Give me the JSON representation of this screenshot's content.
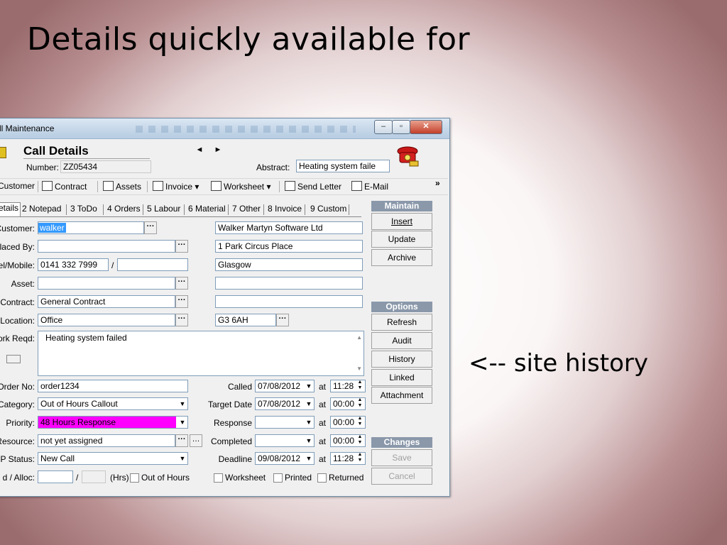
{
  "slide": {
    "title": "Details quickly available for",
    "annotation": "<-- site history"
  },
  "window": {
    "title": "ll Maintenance",
    "controls": {
      "minimize": "–",
      "maximize": "▫",
      "close": "✕"
    }
  },
  "header": {
    "title": "Call Details",
    "number_label": "Number:",
    "number_value": "ZZ05434",
    "abstract_label": "Abstract:",
    "abstract_value": "Heating system faile",
    "nav_prev": "◄",
    "nav_next": "►"
  },
  "toolbar": {
    "items": [
      "Customer",
      "Contract",
      "Assets",
      "Invoice",
      "Worksheet",
      "Send Letter",
      "E-Mail"
    ],
    "overflow": "»"
  },
  "tabs": [
    {
      "label": "etails"
    },
    {
      "label": "2 Notepad"
    },
    {
      "label": "3 ToDo"
    },
    {
      "label": "4 Orders"
    },
    {
      "label": "5 Labour"
    },
    {
      "label": "6 Material"
    },
    {
      "label": "7 Other"
    },
    {
      "label": "8 Invoice"
    },
    {
      "label": "9 Custom"
    }
  ],
  "form": {
    "customer_label": "Customer:",
    "customer_value": "walker",
    "placed_by_label": "laced By:",
    "placed_by_value": "",
    "tel_label": "el/Mobile:",
    "tel_value": "0141 332 7999",
    "tel_sep": "/",
    "mobile_value": "",
    "asset_label": "Asset:",
    "asset_value": "",
    "contract_label": "Contract:",
    "contract_value": "General Contract",
    "location_label": "Location:",
    "location_value": "Office",
    "work_label": "ork Reqd:",
    "work_value": "Heating system failed",
    "address": {
      "line1": "Walker Martyn Software Ltd",
      "line2": "1 Park Circus Place",
      "line3": "Glasgow",
      "line4": "",
      "line5": "",
      "postcode": "G3 6AH"
    },
    "order_label": "Order No:",
    "order_value": "order1234",
    "category_label": "Category:",
    "category_value": "Out of Hours Callout",
    "priority_label": "Priority:",
    "priority_value": "48 Hours Response",
    "resource_label": "Resource:",
    "resource_value": "not yet assigned",
    "status_label": "P Status:",
    "status_value": "New Call",
    "alloc_label": "d / Alloc:",
    "alloc_sep": "/",
    "hrs_label": "(Hrs)",
    "out_of_hours_label": "Out of Hours",
    "called_label": "Called",
    "called_date": "07/08/2012",
    "called_time": "11:28",
    "target_label": "Target Date",
    "target_date": "07/08/2012",
    "target_time": "00:00",
    "response_label": "Response",
    "response_date": "",
    "response_time": "00:00",
    "completed_label": "Completed",
    "completed_date": "",
    "completed_time": "00:00",
    "deadline_label": "Deadline",
    "deadline_date": "09/08/2012",
    "deadline_time": "11:28",
    "at_label": "at",
    "worksheet_label": "Worksheet",
    "printed_label": "Printed",
    "returned_label": "Returned"
  },
  "panel": {
    "maintain_header": "Maintain",
    "insert": "Insert",
    "update": "Update",
    "archive": "Archive",
    "options_header": "Options",
    "refresh": "Refresh",
    "audit": "Audit",
    "history": "History",
    "linked": "Linked",
    "attachment": "Attachment",
    "changes_header": "Changes",
    "save": "Save",
    "cancel": "Cancel"
  },
  "colors": {
    "priority_highlight": "#ff00ff",
    "selection": "#3399ff",
    "panel_header": "#8a98aa"
  }
}
